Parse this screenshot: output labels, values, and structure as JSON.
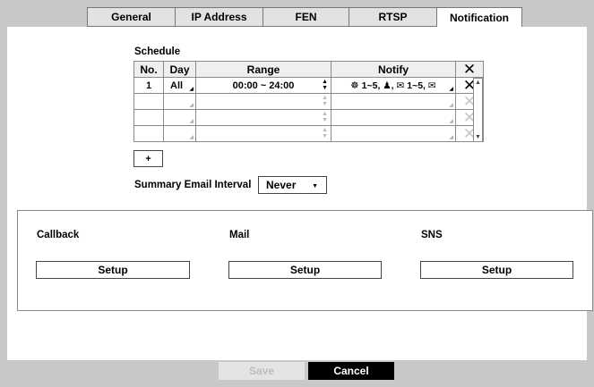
{
  "tabs": [
    {
      "label": "General"
    },
    {
      "label": "IP Address"
    },
    {
      "label": "FEN"
    },
    {
      "label": "RTSP"
    },
    {
      "label": "Notification",
      "active": true
    }
  ],
  "schedule": {
    "title": "Schedule",
    "columns": {
      "no": "No.",
      "day": "Day",
      "range": "Range",
      "notify": "Notify"
    },
    "rows": [
      {
        "no": "1",
        "day": "All",
        "range": "00:00 ~ 24:00",
        "notify": "☸ 1~5, ♟, ✉ 1~5, ✉"
      },
      {
        "no": "",
        "day": "",
        "range": "",
        "notify": ""
      },
      {
        "no": "",
        "day": "",
        "range": "",
        "notify": ""
      },
      {
        "no": "",
        "day": "",
        "range": "",
        "notify": ""
      }
    ],
    "add_label": "+"
  },
  "summary_interval": {
    "label": "Summary Email Interval",
    "value": "Never"
  },
  "notifications": {
    "callback": {
      "title": "Callback",
      "button": "Setup"
    },
    "mail": {
      "title": "Mail",
      "button": "Setup"
    },
    "sns": {
      "title": "SNS",
      "button": "Setup"
    }
  },
  "footer": {
    "save": "Save",
    "cancel": "Cancel"
  },
  "colors": {
    "frame": "#c8c8c8",
    "tab_inactive": "#e2e2e2",
    "disabled_text": "#bdbdbd",
    "cancel_bg": "#000000"
  }
}
